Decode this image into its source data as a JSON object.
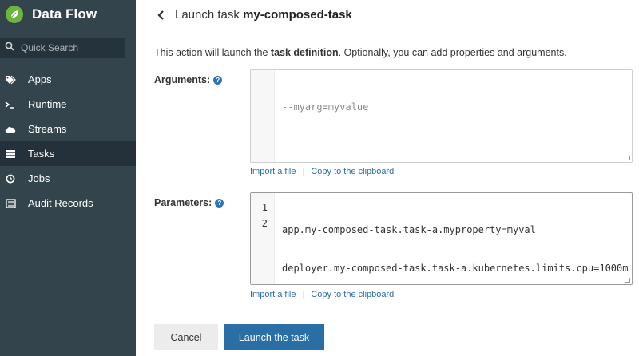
{
  "sidebar": {
    "brand": "Data Flow",
    "search_placeholder": "Quick Search",
    "items": [
      {
        "label": "Apps",
        "icon": "tags-icon"
      },
      {
        "label": "Runtime",
        "icon": "terminal-icon"
      },
      {
        "label": "Streams",
        "icon": "cloud-icon"
      },
      {
        "label": "Tasks",
        "icon": "server-icon",
        "active": true
      },
      {
        "label": "Jobs",
        "icon": "clock-icon"
      },
      {
        "label": "Audit Records",
        "icon": "list-icon"
      }
    ]
  },
  "header": {
    "prefix": "Launch task",
    "task_name": "my-composed-task"
  },
  "intro": {
    "part1": "This action will launch the ",
    "bold": "task definition",
    "part2": ". Optionally, you can add properties and arguments."
  },
  "arguments": {
    "label": "Arguments:",
    "placeholder": "--myarg=myvalue",
    "import_link": "Import a file",
    "copy_link": "Copy to the clipboard"
  },
  "parameters": {
    "label": "Parameters:",
    "lines": [
      {
        "num": "1",
        "text": "app.my-composed-task.task-a.myproperty=myval"
      },
      {
        "num": "2",
        "text": "deployer.my-composed-task.task-a.kubernetes.limits.cpu=1000m"
      }
    ],
    "import_link": "Import a file",
    "copy_link": "Copy to the clipboard"
  },
  "buttons": {
    "cancel": "Cancel",
    "launch": "Launch the task"
  },
  "colors": {
    "sidebar_bg": "#34444c",
    "sidebar_active": "#24313a",
    "brand_green": "#6db33f",
    "primary": "#2a6ea6",
    "link": "#2a6ea6"
  }
}
